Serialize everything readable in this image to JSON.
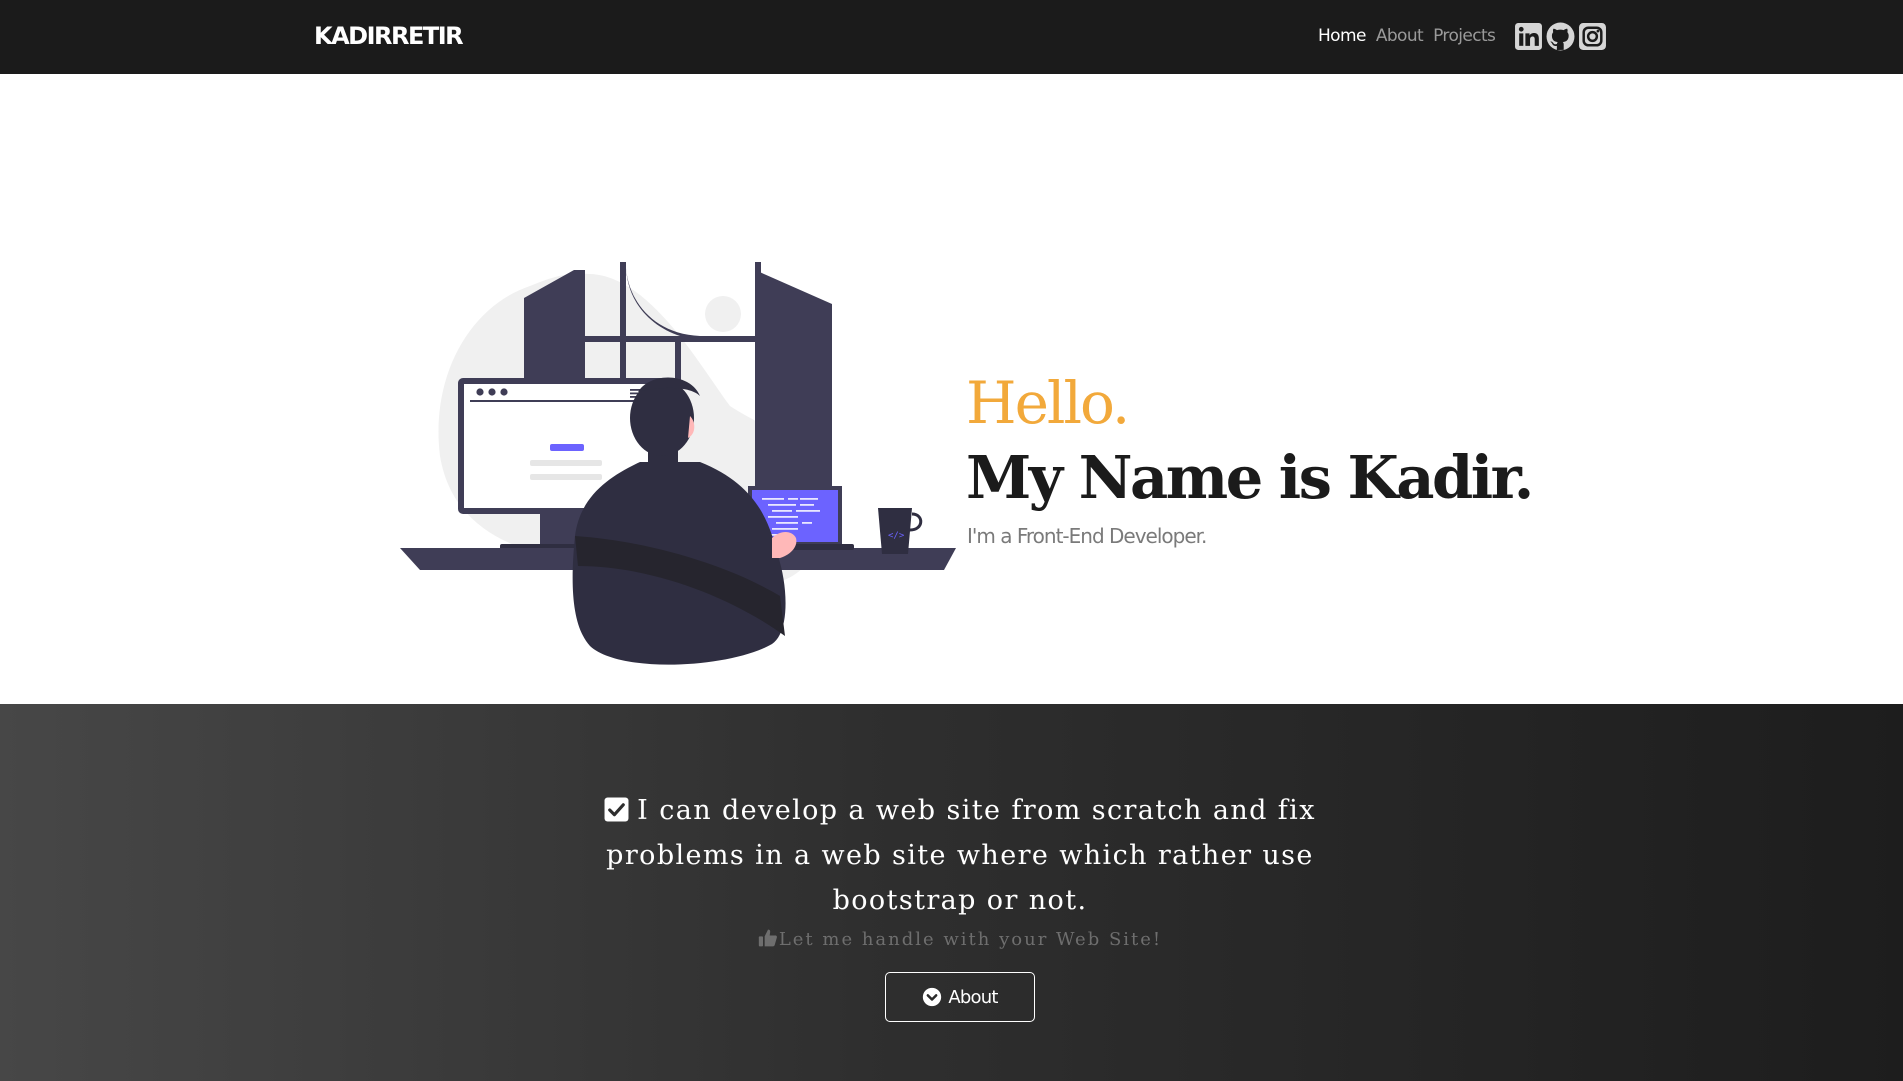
{
  "navbar": {
    "brand": "KADIRRETIR",
    "links": [
      {
        "label": "Home",
        "active": true
      },
      {
        "label": "About",
        "active": false
      },
      {
        "label": "Projects",
        "active": false
      }
    ],
    "socials": [
      "linkedin-icon",
      "github-icon",
      "instagram-icon"
    ]
  },
  "hero": {
    "greeting": "Hello.",
    "name": "My Name is Kadir.",
    "subtitle": "I'm a Front-End Developer.",
    "illustration": "developer-at-desk-illustration"
  },
  "about": {
    "statement": "I can develop a web site from scratch and fix problems in a web site where which rather use bootstrap or not.",
    "tagline": "Let me handle with your Web Site!",
    "button_label": "About"
  },
  "colors": {
    "navbar_bg": "#1b1b1b",
    "accent": "#f2a93b",
    "screen_accent": "#6c63ff",
    "dark_figure": "#3f3d56"
  }
}
